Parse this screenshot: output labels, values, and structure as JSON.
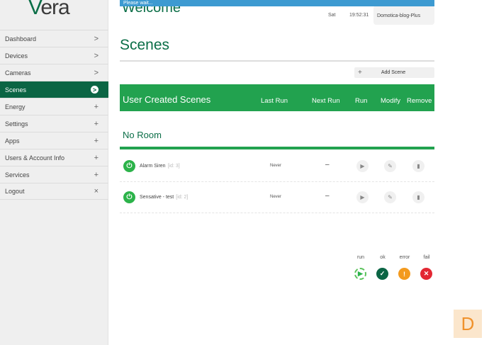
{
  "logo": {
    "mark": "V",
    "rest": "era"
  },
  "sidebar": {
    "items": [
      {
        "label": "Dashboard",
        "icon": ">"
      },
      {
        "label": "Devices",
        "icon": ">"
      },
      {
        "label": "Cameras",
        "icon": ">"
      },
      {
        "label": "Scenes",
        "icon": ">"
      },
      {
        "label": "Energy",
        "icon": "+"
      },
      {
        "label": "Settings",
        "icon": "+"
      },
      {
        "label": "Apps",
        "icon": "+"
      },
      {
        "label": "Users & Account Info",
        "icon": "+"
      },
      {
        "label": "Services",
        "icon": "+"
      },
      {
        "label": "Logout",
        "icon": "×"
      }
    ]
  },
  "header": {
    "status": "Please wait...",
    "welcome": "Welcome",
    "day": "Sat",
    "time": "19:52:31",
    "user": "Domotica-blog-Plus"
  },
  "page": {
    "title": "Scenes",
    "add_label": "Add Scene",
    "add_icon": "+"
  },
  "table": {
    "title": "User Created Scenes",
    "cols": [
      "Last Run",
      "Next Run",
      "Run",
      "Modify",
      "Remove"
    ],
    "room": "No Room",
    "rows": [
      {
        "name": "Alarm Siren",
        "id": "[id: 3]",
        "last": "Never",
        "next": "–"
      },
      {
        "name": "Sensative - test",
        "id": "[id: 2]",
        "last": "Never",
        "next": "–"
      }
    ]
  },
  "legend": {
    "run": "run",
    "ok": "ok",
    "error": "error",
    "fail": "fail"
  },
  "corner": "D",
  "colors": {
    "brand": "#0b6544",
    "accent": "#22a24f",
    "ok": "#0b6544",
    "error": "#f39a1e",
    "fail": "#e32733"
  }
}
